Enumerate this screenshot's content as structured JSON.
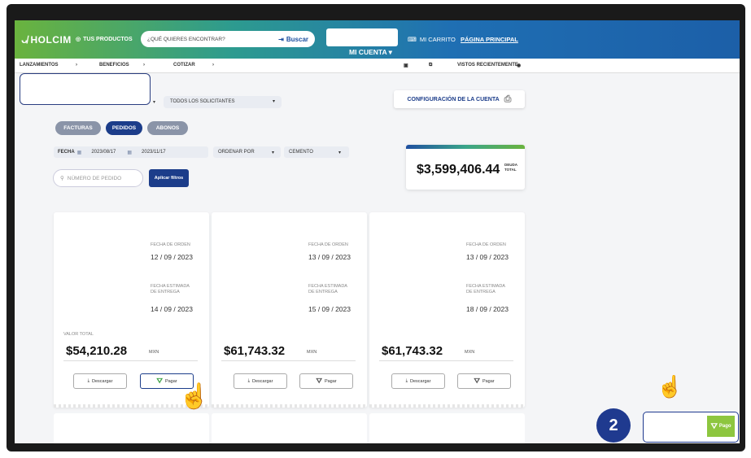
{
  "header": {
    "logo": "HOLCIM",
    "products": "TUS PRODUCTOS",
    "search_placeholder": "¿QUÉ QUIERES ENCONTRAR?",
    "search_button": "Buscar",
    "account": "MI CUENTA",
    "cart": "MI CARRITO",
    "home": "PÁGINA PRINCIPAL"
  },
  "nav": {
    "items": [
      "LANZAMIENTOS",
      "BENEFICIOS",
      "COTIZAR"
    ],
    "recent": "VISTOS RECIENTEMENTE"
  },
  "filters": {
    "solicitantes": "TODOS LOS SOLICITANTES",
    "config": "CONFIGURACIÓN DE LA CUENTA",
    "tabs": [
      "FACTURAS",
      "PEDIDOS",
      "ABONOS"
    ],
    "date_label": "FECHA",
    "date_from": "2023/08/17",
    "date_to": "2023/11/17",
    "sort": "ORDENAR POR",
    "product": "CEMENTO",
    "order_search_placeholder": "NÚMERO DE PEDIDO",
    "apply": "Aplicar filtros"
  },
  "total": {
    "amount": "$3,599,406.44",
    "label_line1": "DEUDA",
    "label_line2": "TOTAL"
  },
  "labels": {
    "order_date": "FECHA DE ORDEN",
    "delivery_1": "FECHA ESTIMADA",
    "delivery_2": "DE ENTREGA",
    "total_value": "VALOR TOTAL",
    "currency": "MXN",
    "download": "Descargar",
    "pay": "Pagar",
    "pay_short": "Pago"
  },
  "orders": [
    {
      "order_date": "12 / 09 / 2023",
      "delivery_date": "14 / 09 / 2023",
      "amount": "$54,210.28"
    },
    {
      "order_date": "13 / 09 / 2023",
      "delivery_date": "15 / 09 / 2023",
      "amount": "$61,743.32"
    },
    {
      "order_date": "13 / 09 / 2023",
      "delivery_date": "18 / 09 / 2023",
      "amount": "$61,743.32"
    }
  ],
  "step_number": "2",
  "colors": {
    "brand_blue": "#1c3d8a",
    "brand_green": "#8dc63f"
  }
}
